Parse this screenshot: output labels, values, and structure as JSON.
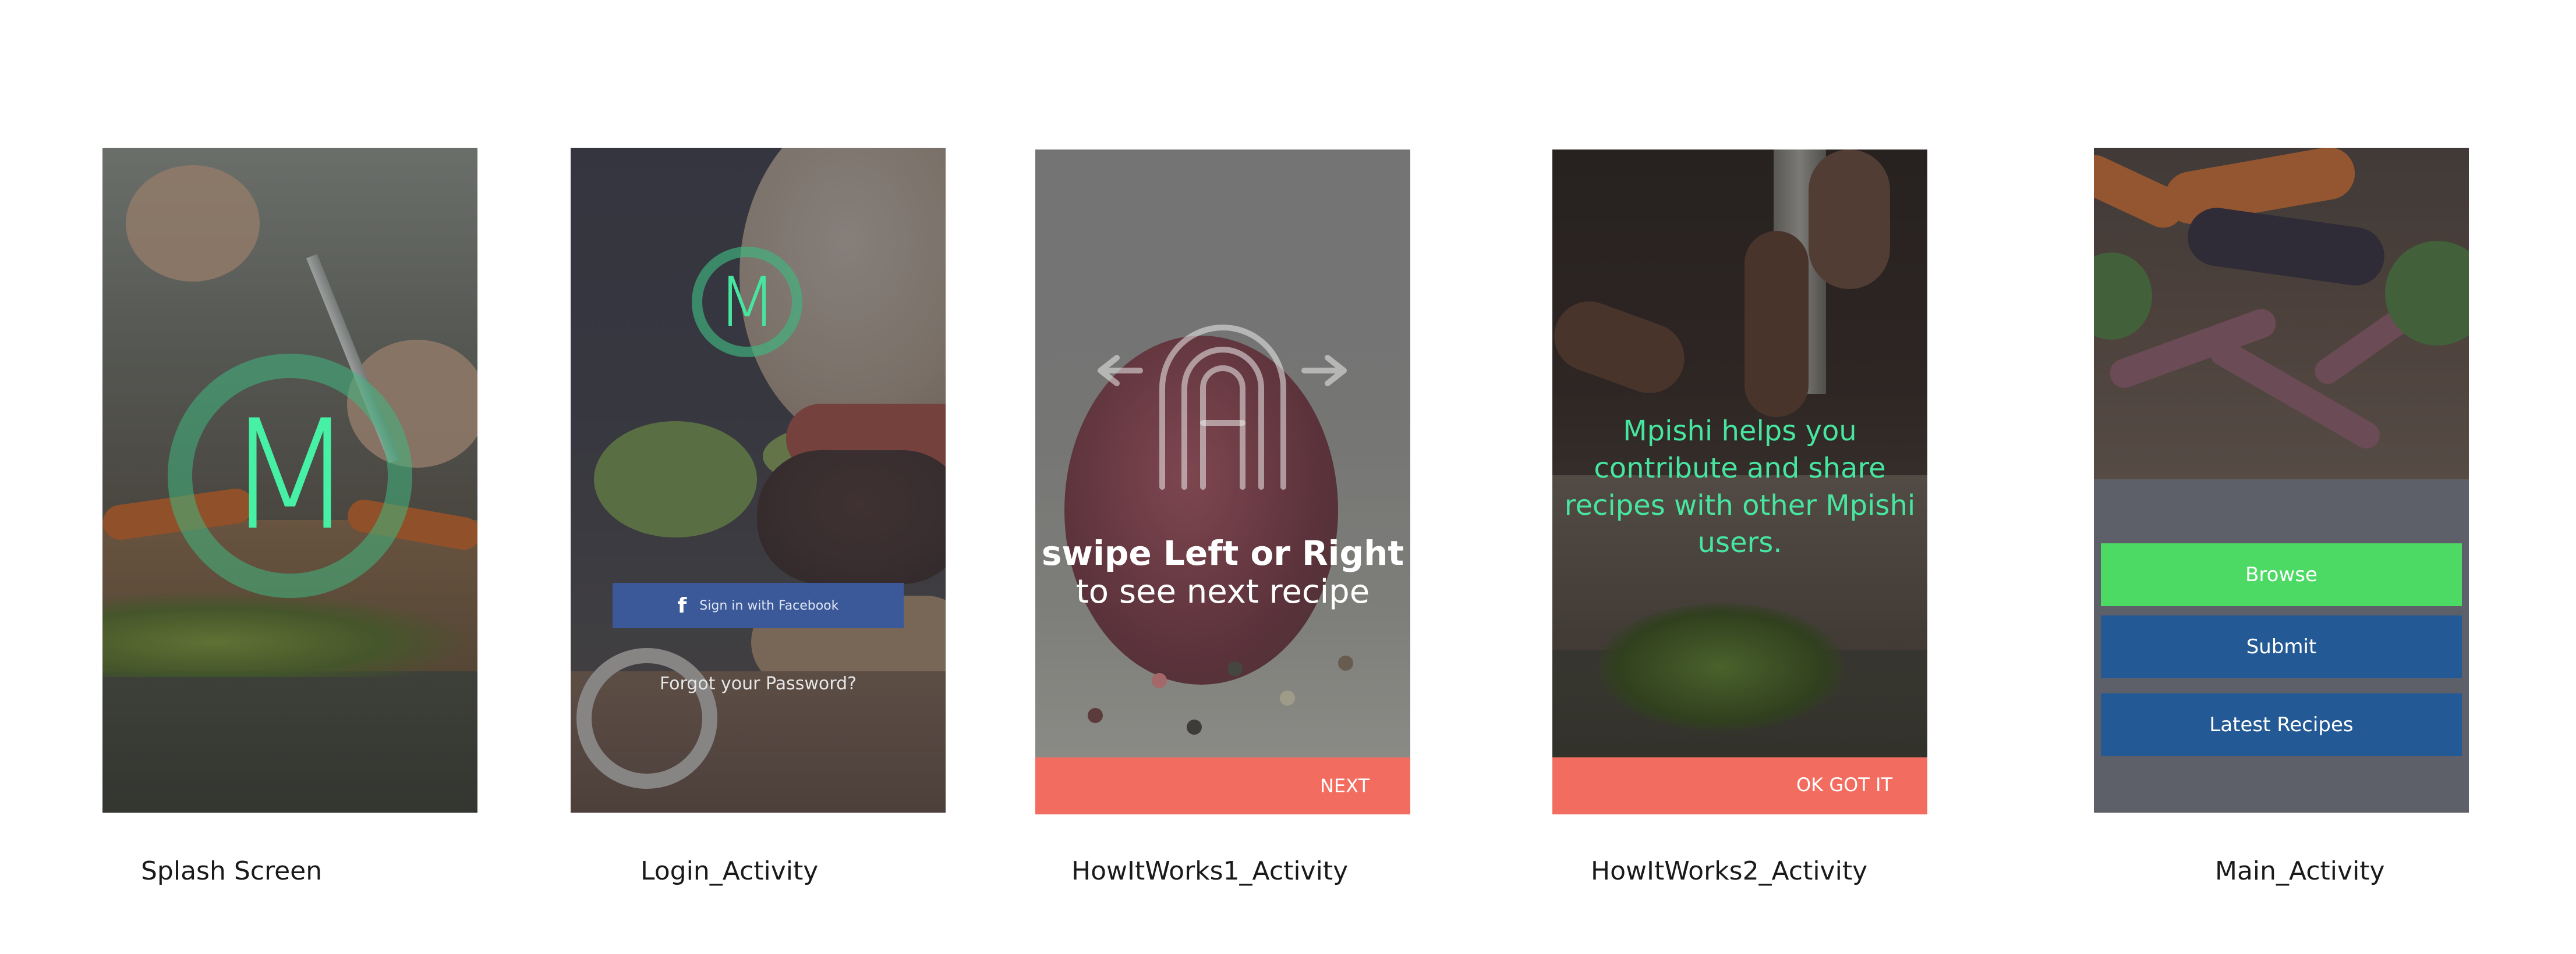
{
  "captions": {
    "splash": "Splash Screen",
    "login": "Login_Activity",
    "how1": "HowItWorks1_Activity",
    "how2": "HowItWorks2_Activity",
    "main": "Main_Activity"
  },
  "splash": {
    "logo_letter": "M"
  },
  "login": {
    "logo_letter": "M",
    "facebook_icon": "f",
    "facebook_label": "Sign in with Facebook",
    "forgot_password": "Forgot your Password?"
  },
  "how1": {
    "line1": "swipe Left or Right",
    "line2": "to see next recipe",
    "next": "NEXT",
    "icon": "swipe-gesture-icon"
  },
  "how2": {
    "message": "Mpishi helps you contribute and share recipes with other Mpishi users.",
    "ok": "OK GOT IT"
  },
  "main": {
    "browse": "Browse",
    "submit": "Submit",
    "latest": "Latest Recipes"
  },
  "colors": {
    "accent_green": "#46f0a4",
    "facebook_blue": "#3b5998",
    "coral": "#f26d5f",
    "browse_green": "#4cd964",
    "button_blue": "#235a96"
  }
}
